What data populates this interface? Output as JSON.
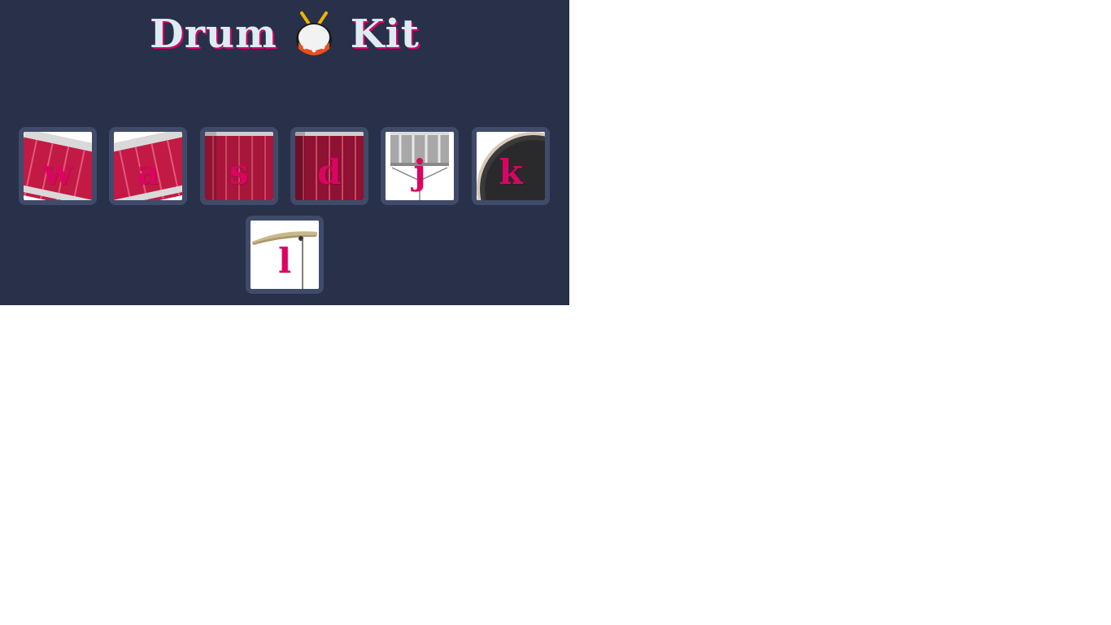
{
  "header": {
    "title_left": "Drum",
    "title_emoji": "drum-emoji",
    "title_right": "Kit"
  },
  "pads": [
    {
      "key": "w",
      "instrument_icon": "tom-drum-icon"
    },
    {
      "key": "a",
      "instrument_icon": "tom-drum-icon"
    },
    {
      "key": "s",
      "instrument_icon": "snare-drum-icon"
    },
    {
      "key": "d",
      "instrument_icon": "snare-drum-icon"
    },
    {
      "key": "j",
      "instrument_icon": "silver-drum-icon"
    },
    {
      "key": "k",
      "instrument_icon": "bass-drum-icon"
    },
    {
      "key": "l",
      "instrument_icon": "cymbal-icon"
    }
  ],
  "colors": {
    "background": "#283149",
    "pad_border": "#404b69",
    "key_text": "#da0463",
    "title_text": "#dbedf3"
  }
}
